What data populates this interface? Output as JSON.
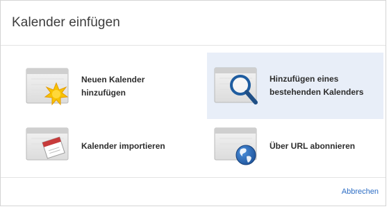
{
  "dialog": {
    "title": "Kalender einfügen",
    "options": [
      {
        "label": "Neuen Kalender hinzufügen",
        "icon": "new-calendar-icon",
        "selected": false
      },
      {
        "label": "Hinzufügen eines bestehenden Kalenders",
        "icon": "search-calendar-icon",
        "selected": true
      },
      {
        "label": "Kalender importieren",
        "icon": "import-calendar-icon",
        "selected": false
      },
      {
        "label": "Über URL abonnieren",
        "icon": "globe-calendar-icon",
        "selected": false
      }
    ],
    "cancel_label": "Abbrechen"
  },
  "colors": {
    "accent": "#2b6cc4",
    "selected_bg": "#e8eef8"
  }
}
